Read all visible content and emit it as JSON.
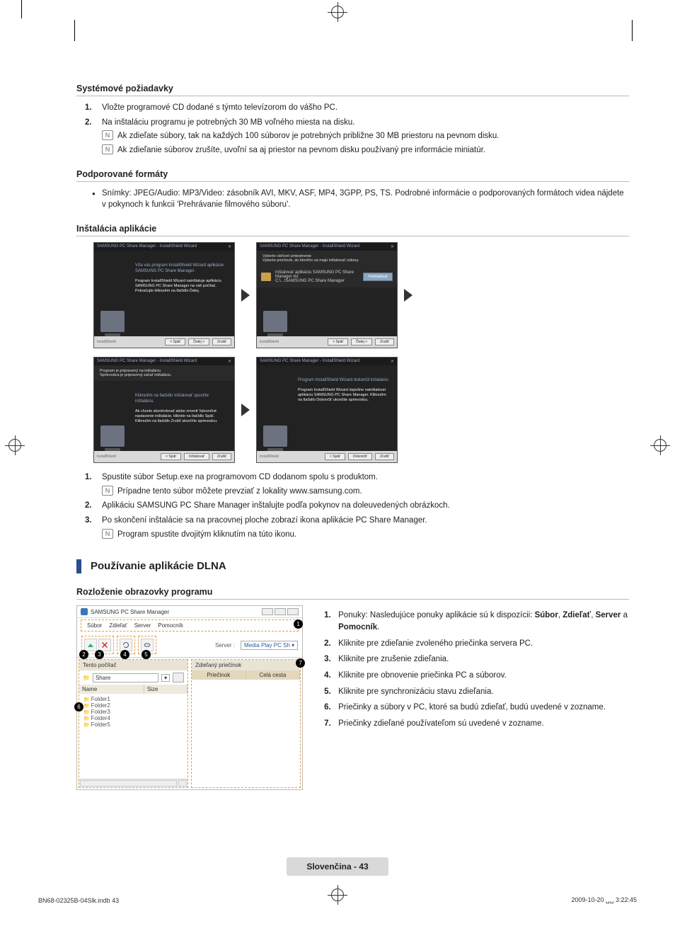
{
  "sections": {
    "sys_req": {
      "title": "Systémové požiadavky",
      "items": [
        "Vložte programové CD dodané s týmto televízorom do vášho PC.",
        "Na inštaláciu programu je potrebných 30 MB voľného miesta na disku."
      ],
      "notes": [
        "Ak zdieľate súbory, tak na každých 100 súborov je potrebných približne 30 MB priestoru na pevnom disku.",
        "Ak zdieľanie súborov zrušíte, uvoľní sa aj priestor na pevnom disku používaný pre informácie miniatúr."
      ]
    },
    "formats": {
      "title": "Podporované formáty",
      "bullet": "Snímky: JPEG/Audio: MP3/Video: zásobník AVI, MKV, ASF, MP4, 3GPP, PS, TS. Podrobné informácie o podporovaných formátoch videa nájdete v pokynoch k funkcii 'Prehrávanie filmového súboru'."
    },
    "install": {
      "title": "Inštalácia aplikácie",
      "wizard_title": "SAMSUNG PC Share Manager - InstallShield Wizard",
      "w1_lead": "Víta vás program InstallShield Wizard aplikácie SAMSUNG PC Share Manager.",
      "w1_body": "Program InstallShield Wizard nainštaluje aplikáciu SAMSUNG PC Share Manager na váš počítač. Pokračujte kliknutím na tlačidlo Ďalej.",
      "w2_sub_a": "Vyberte cieľové umiestnenie",
      "w2_sub_b": "Vyberte priečinok, do ktorého sa majú inštalovať súbory.",
      "w2_path_a": "Inštalovať aplikáciu SAMSUNG PC Share Manager do:",
      "w2_path_b": "C:\\...\\SAMSUNG PC Share Manager",
      "w2_browse": "Prehľadávať",
      "w3_sub_a": "Program je pripravený na inštaláciu",
      "w3_sub_b": "Sprievodca je pripravený začať inštaláciu.",
      "w3_lead": "Kliknutím na tlačidlo Inštalovať spustíte inštaláciu.",
      "w3_body": "Ak chcete skontrolovať alebo zmeniť ľubovoľné nastavenie inštalácie, kliknite na tlačidlo Späť. Kliknutím na tlačidlo Zrušiť ukončíte sprievodcu.",
      "w4_lead": "Program InstallShield Wizard dokončil inštaláciu",
      "w4_body": "Program InstallShield Wizard úspešne nainštaloval aplikáciu SAMSUNG PC Share Manager. Kliknutím na tlačidlo Dokončiť ukončite sprievodcu.",
      "btn_back": "< Späť",
      "btn_next": "Ďalej >",
      "btn_cancel": "Zrušiť",
      "btn_finish": "Dokončiť",
      "btn_install": "Inštalovať",
      "id_label": "InstallShield",
      "steps": [
        "Spustite súbor Setup.exe na programovom CD dodanom spolu s produktom.",
        "Aplikáciu SAMSUNG PC Share Manager inštalujte podľa pokynov na doleuvedených obrázkoch.",
        "Po skončení inštalácie sa na pracovnej ploche zobrazí ikona aplikácie PC Share Manager."
      ],
      "step_note1": "Prípadne tento súbor môžete prevziať z lokality www.samsung.com.",
      "step_note3": "Program spustite dvojitým kliknutím na túto ikonu."
    },
    "dlna": {
      "title": "Používanie aplikácie DLNA"
    },
    "layout": {
      "title": "Rozloženie obrazovky programu",
      "app_title": "SAMSUNG PC Share Manager",
      "menus": [
        "Súbor",
        "Zdieľať",
        "Server",
        "Pomocník"
      ],
      "server_label": "Server :",
      "server_value": "Media Play PC Sh ▾",
      "left_header": "Tento počítač",
      "right_header": "Zdieľaný priečinok",
      "path_value": "Share",
      "col_name": "Name",
      "col_size": "Size",
      "rcol_a": "Priečinok",
      "rcol_b": "Celá cesta",
      "folders": [
        "Folder1",
        "Folder2",
        "Folder3",
        "Folder4",
        "Folder5"
      ],
      "legend": [
        {
          "pre": "Ponuky: Nasledujúce ponuky aplikácie sú k dispozícii: ",
          "bolds": [
            "Súbor",
            "Zdieľať",
            "Server"
          ],
          "tail_bold": "Pomocník",
          "tail": "."
        },
        "Kliknite pre zdieľanie zvoleného priečinka servera PC.",
        "Kliknite pre zrušenie zdieľania.",
        "Kliknite pre obnovenie priečinka PC a súborov.",
        "Kliknite pre synchronizáciu stavu zdieľania.",
        "Priečinky a súbory v PC, ktoré sa budú zdieľať, budú uvedené v zozname.",
        "Priečinky zdieľané používateľom sú uvedené v zozname."
      ]
    }
  },
  "footer": {
    "label": "Slovenčina - 43"
  },
  "meta": {
    "left": "BN68-02325B-04Slk.indb   43",
    "right": "2009-10-20   ␣␣ 3:22:45"
  }
}
